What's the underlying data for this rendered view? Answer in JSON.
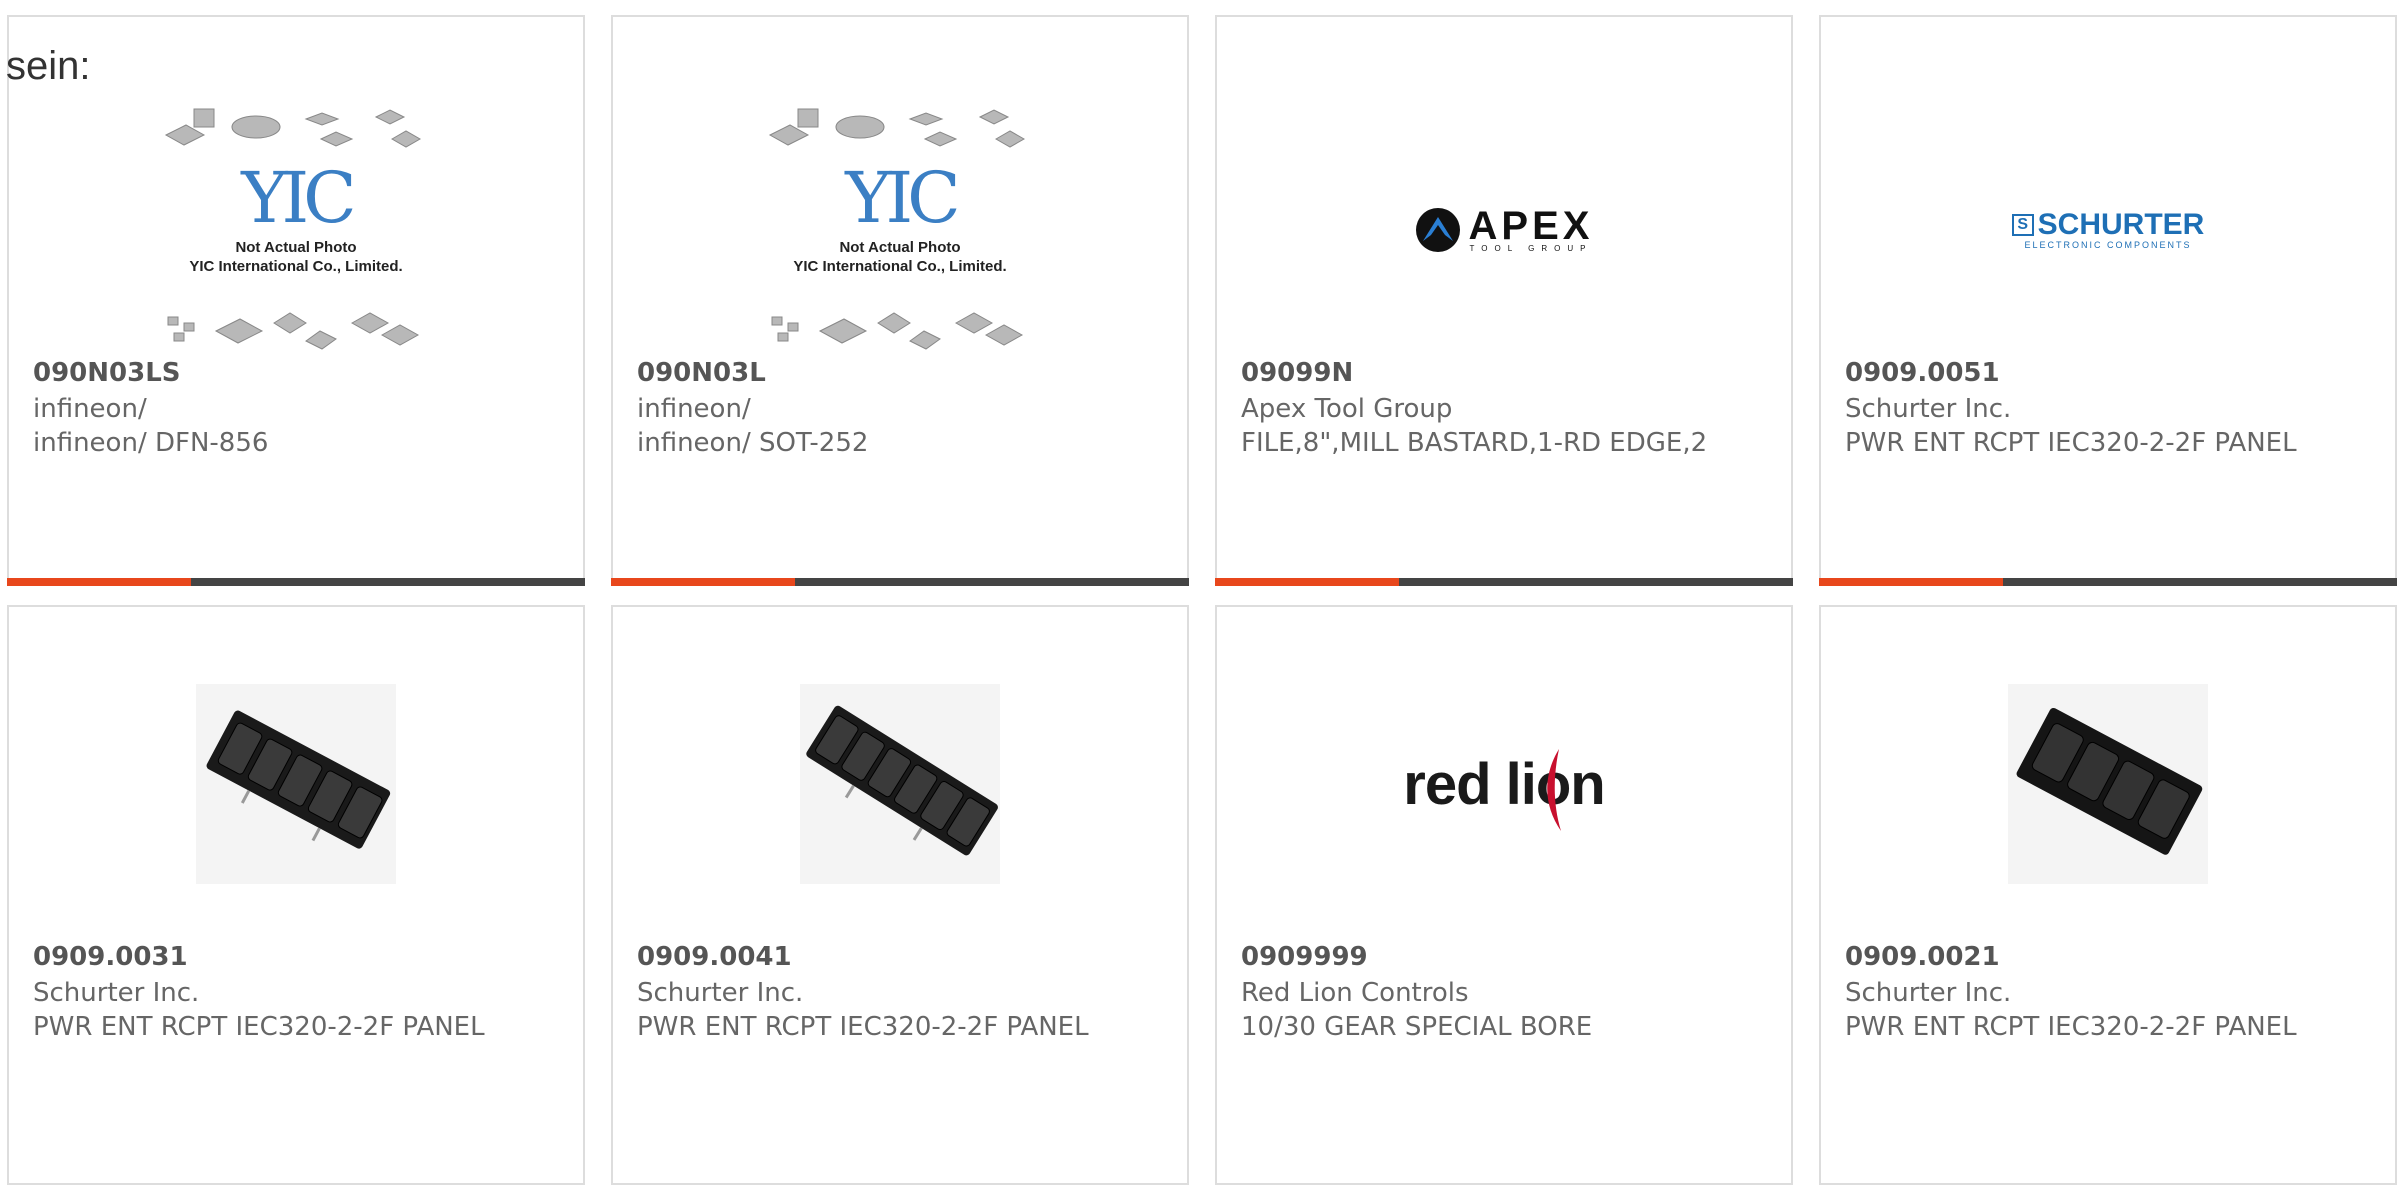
{
  "heading": "sein:",
  "placeholder": {
    "logo_text": "YIC",
    "caption_line1": "Not Actual Photo",
    "caption_line2": "YIC International Co., Limited."
  },
  "brand_logos": {
    "apex": {
      "word": "APEX",
      "sub": "TOOL GROUP"
    },
    "schurter": {
      "mark": "S",
      "word": "SCHURTER",
      "sub": "ELECTRONIC COMPONENTS"
    },
    "redlion": {
      "word": "red lion"
    }
  },
  "colors": {
    "accent": "#e8471c",
    "bar": "#444444",
    "text": "#666666",
    "part": "#555555"
  },
  "products": [
    {
      "part": "090N03LS",
      "manufacturer": "infineon/",
      "description": "infineon/ DFN-856",
      "image": "yic-placeholder"
    },
    {
      "part": "090N03L",
      "manufacturer": "infineon/",
      "description": "infineon/ SOT-252",
      "image": "yic-placeholder"
    },
    {
      "part": "09099N",
      "manufacturer": "Apex Tool Group",
      "description": "FILE,8\",MILL BASTARD,1-RD EDGE,2",
      "image": "apex-logo"
    },
    {
      "part": "0909.0051",
      "manufacturer": "Schurter Inc.",
      "description": "PWR ENT RCPT IEC320-2-2F PANEL",
      "image": "schurter-logo"
    },
    {
      "part": "0909.0031",
      "manufacturer": "Schurter Inc.",
      "description": "PWR ENT RCPT IEC320-2-2F PANEL",
      "image": "power-strip-5"
    },
    {
      "part": "0909.0041",
      "manufacturer": "Schurter Inc.",
      "description": "PWR ENT RCPT IEC320-2-2F PANEL",
      "image": "power-strip-6"
    },
    {
      "part": "0909999",
      "manufacturer": "Red Lion Controls",
      "description": "10/30 GEAR SPECIAL BORE",
      "image": "redlion-logo"
    },
    {
      "part": "0909.0021",
      "manufacturer": "Schurter Inc.",
      "description": "PWR ENT RCPT IEC320-2-2F PANEL",
      "image": "power-strip-4"
    }
  ]
}
